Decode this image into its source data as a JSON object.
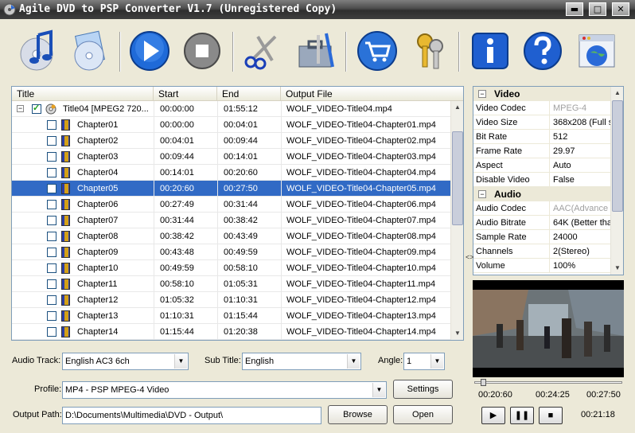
{
  "window": {
    "title": "Agile DVD to PSP Converter V1.7 (Unregistered Copy)",
    "min_glyph": "▬",
    "max_glyph": "□",
    "close_glyph": "✕"
  },
  "toolbar": {
    "items": [
      "music-disc",
      "load-disc",
      "convert",
      "stop",
      "cut",
      "settings-tools",
      "buy",
      "register",
      "about",
      "help",
      "website"
    ]
  },
  "grid": {
    "columns": [
      "Title",
      "Start",
      "End",
      "Output File"
    ],
    "title_row": {
      "title": "Title04 [MPEG2 720...",
      "start": "00:00:00",
      "end": "01:55:12",
      "output": "WOLF_VIDEO-Title04.mp4",
      "checked": true,
      "expander": "−"
    },
    "rows": [
      {
        "title": "Chapter01",
        "start": "00:00:00",
        "end": "00:04:01",
        "output": "WOLF_VIDEO-Title04-Chapter01.mp4",
        "selected": false
      },
      {
        "title": "Chapter02",
        "start": "00:04:01",
        "end": "00:09:44",
        "output": "WOLF_VIDEO-Title04-Chapter02.mp4",
        "selected": false
      },
      {
        "title": "Chapter03",
        "start": "00:09:44",
        "end": "00:14:01",
        "output": "WOLF_VIDEO-Title04-Chapter03.mp4",
        "selected": false
      },
      {
        "title": "Chapter04",
        "start": "00:14:01",
        "end": "00:20:60",
        "output": "WOLF_VIDEO-Title04-Chapter04.mp4",
        "selected": false
      },
      {
        "title": "Chapter05",
        "start": "00:20:60",
        "end": "00:27:50",
        "output": "WOLF_VIDEO-Title04-Chapter05.mp4",
        "selected": true
      },
      {
        "title": "Chapter06",
        "start": "00:27:49",
        "end": "00:31:44",
        "output": "WOLF_VIDEO-Title04-Chapter06.mp4",
        "selected": false
      },
      {
        "title": "Chapter07",
        "start": "00:31:44",
        "end": "00:38:42",
        "output": "WOLF_VIDEO-Title04-Chapter07.mp4",
        "selected": false
      },
      {
        "title": "Chapter08",
        "start": "00:38:42",
        "end": "00:43:49",
        "output": "WOLF_VIDEO-Title04-Chapter08.mp4",
        "selected": false
      },
      {
        "title": "Chapter09",
        "start": "00:43:48",
        "end": "00:49:59",
        "output": "WOLF_VIDEO-Title04-Chapter09.mp4",
        "selected": false
      },
      {
        "title": "Chapter10",
        "start": "00:49:59",
        "end": "00:58:10",
        "output": "WOLF_VIDEO-Title04-Chapter10.mp4",
        "selected": false
      },
      {
        "title": "Chapter11",
        "start": "00:58:10",
        "end": "01:05:31",
        "output": "WOLF_VIDEO-Title04-Chapter11.mp4",
        "selected": false
      },
      {
        "title": "Chapter12",
        "start": "01:05:32",
        "end": "01:10:31",
        "output": "WOLF_VIDEO-Title04-Chapter12.mp4",
        "selected": false
      },
      {
        "title": "Chapter13",
        "start": "01:10:31",
        "end": "01:15:44",
        "output": "WOLF_VIDEO-Title04-Chapter13.mp4",
        "selected": false
      },
      {
        "title": "Chapter14",
        "start": "01:15:44",
        "end": "01:20:38",
        "output": "WOLF_VIDEO-Title04-Chapter14.mp4",
        "selected": false
      }
    ]
  },
  "properties": {
    "video_group": "Video",
    "audio_group": "Audio",
    "group_expander": "−",
    "video": [
      {
        "name": "Video Codec",
        "value": "MPEG-4",
        "disabled": true
      },
      {
        "name": "Video Size",
        "value": "368x208 (Full s",
        "disabled": false
      },
      {
        "name": "Bit Rate",
        "value": "512",
        "disabled": false
      },
      {
        "name": "Frame Rate",
        "value": "29.97",
        "disabled": false
      },
      {
        "name": "Aspect",
        "value": "Auto",
        "disabled": false
      },
      {
        "name": "Disable Video",
        "value": "False",
        "disabled": false
      }
    ],
    "audio": [
      {
        "name": "Audio Codec",
        "value": "AAC(Advance",
        "disabled": true
      },
      {
        "name": "Audio Bitrate",
        "value": "64K (Better tha",
        "disabled": false
      },
      {
        "name": "Sample Rate",
        "value": "24000",
        "disabled": false
      },
      {
        "name": "Channels",
        "value": "2(Stereo)",
        "disabled": false
      },
      {
        "name": "Volume",
        "value": "100%",
        "disabled": false
      }
    ]
  },
  "player": {
    "seek_fraction": 0.04,
    "time_start": "00:20:60",
    "time_current": "00:24:25",
    "time_end": "00:27:50",
    "elapsed": "00:21:18",
    "play_glyph": "▶",
    "pause_glyph": "❚❚",
    "stop_glyph": "■"
  },
  "controls": {
    "audio_track_label": "Audio Track:",
    "audio_track_value": "English AC3 6ch",
    "subtitle_label": "Sub Title:",
    "subtitle_value": "English",
    "angle_label": "Angle:",
    "angle_value": "1",
    "profile_label": "Profile:",
    "profile_value": "MP4 - PSP MPEG-4 Video",
    "settings_button": "Settings",
    "output_label": "Output Path:",
    "output_value": "D:\\Documents\\Multimedia\\DVD - Output\\",
    "browse_button": "Browse",
    "open_button": "Open",
    "dropdown_glyph": "▼"
  },
  "splitter_glyph": "<>",
  "colors": {
    "selection": "#316ac5",
    "window_bg": "#ece9d8",
    "border": "#7f9db9"
  }
}
